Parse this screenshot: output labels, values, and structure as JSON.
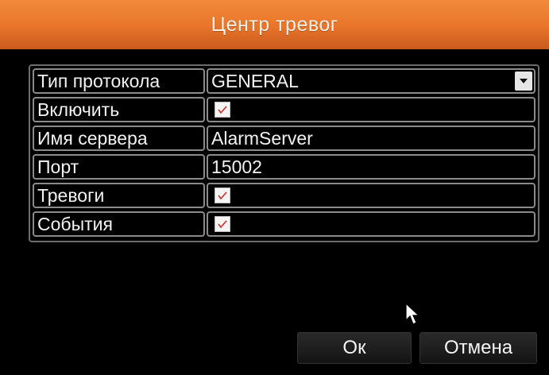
{
  "window": {
    "title": "Центр тревог"
  },
  "form": {
    "rows": [
      {
        "label": "Тип протокола",
        "type": "select",
        "value": "GENERAL"
      },
      {
        "label": "Включить",
        "type": "checkbox",
        "checked": true
      },
      {
        "label": "Имя сервера",
        "type": "text",
        "value": "AlarmServer"
      },
      {
        "label": "Порт",
        "type": "text",
        "value": "15002"
      },
      {
        "label": "Тревоги",
        "type": "checkbox",
        "checked": true
      },
      {
        "label": "События",
        "type": "checkbox",
        "checked": true
      }
    ]
  },
  "buttons": {
    "ok_label": "Ок",
    "cancel_label": "Отмена"
  },
  "colors": {
    "titlebar": "#e8742a",
    "checkmark": "#d12a2a",
    "background": "#000000"
  },
  "icons": {
    "dropdown": "chevron-down-icon",
    "check": "checkmark-icon",
    "pointer": "mouse-pointer-icon"
  }
}
